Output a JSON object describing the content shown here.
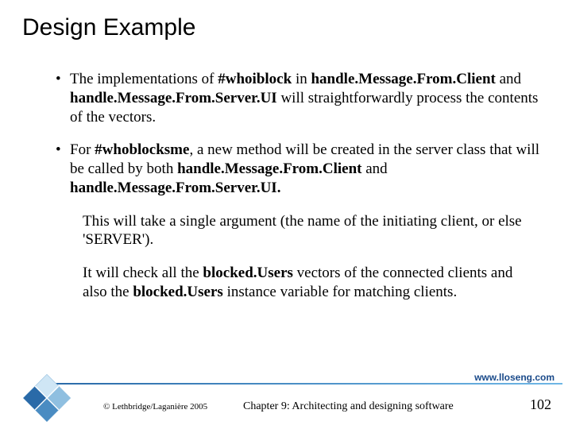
{
  "title": "Design Example",
  "body": {
    "p1_a": "The implementations of ",
    "p1_b": "#whoiblock",
    "p1_c": " in ",
    "p1_d": "handle.Message.From.Client",
    "p1_e": " and ",
    "p1_f": "handle.Message.From.Server.UI",
    "p1_g": " will straightforwardly process the contents of the vectors.",
    "p2_a": "For ",
    "p2_b": "#whoblocksme",
    "p2_c": ", a new method will be created in the server class that will be called by both ",
    "p2_d": "handle.Message.From.Client",
    "p2_e": " and ",
    "p2_f": "handle.Message.From.Server.UI.",
    "p3": "This will take a single argument (the name of the initiating client, or else 'SERVER').",
    "p4_a": "It will check all the ",
    "p4_b": "blocked.Users",
    "p4_c": " vectors of the connected clients and also the ",
    "p4_d": "blocked.Users",
    "p4_e": " instance variable for matching clients."
  },
  "footer": {
    "url": "www.lloseng.com",
    "copyright": "© Lethbridge/Laganière 2005",
    "chapter": "Chapter 9: Architecting and designing software",
    "pagenum": "102"
  }
}
